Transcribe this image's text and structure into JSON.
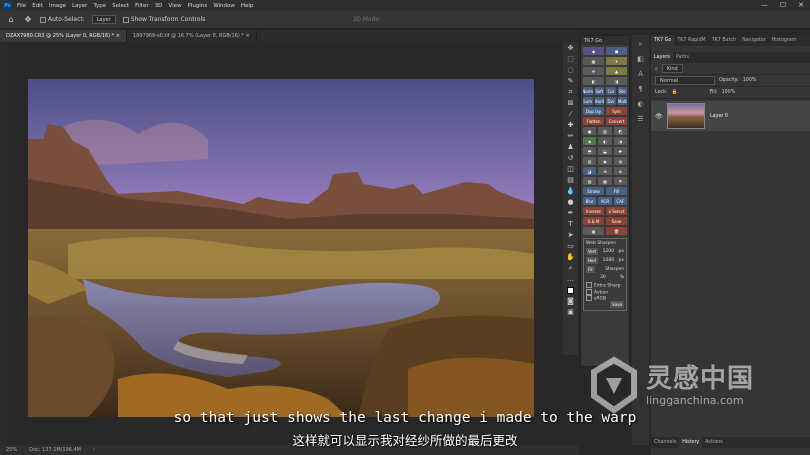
{
  "app": {
    "logo": "Ps"
  },
  "menu": [
    "File",
    "Edit",
    "Image",
    "Layer",
    "Type",
    "Select",
    "Filter",
    "3D",
    "View",
    "Plugins",
    "Window",
    "Help"
  ],
  "window_controls": [
    "—",
    "☐",
    "✕"
  ],
  "options_bar": {
    "auto_select_label": "Auto-Select:",
    "layer_dropdown": "Layer",
    "transform_label": "Show Transform Controls",
    "mode_3d": "3D Mode:"
  },
  "doc_tabs": [
    {
      "label": "DZAX7980.CR3 @ 25% (Layer 0, RGB/16) *",
      "close": "×"
    },
    {
      "label": "1897969-s0.tif @ 16.7% (Layer 0, RGB/16) *",
      "close": "×"
    }
  ],
  "status": {
    "zoom": "25%",
    "doc": "Doc: 137.1M/196.4M",
    "arrow": "›"
  },
  "t7_panel": {
    "title": "TK7 Go",
    "rows": [
      [
        "Norm",
        "Soft",
        "Col",
        "Sto"
      ],
      [
        "Lum",
        "Hard",
        "Dvi",
        "Mult"
      ],
      [
        "Dup lay",
        "Sym"
      ],
      [
        "Flatten",
        "Convert"
      ],
      [
        "Stroke",
        "Fill"
      ],
      [
        "Blur",
        "ACR",
        "CAF"
      ],
      [
        "Inverse",
        "x Select"
      ],
      [
        "S & M",
        "Save"
      ]
    ],
    "web_sharpen": {
      "title": "Web Sharpen",
      "vert_label": "Vert",
      "vert_value": "1200",
      "vert_unit": "px",
      "hori_label": "Hori",
      "hori_value": "1080",
      "hori_unit": "px",
      "fit_label": "Fit",
      "fit_caption": "Sharpen",
      "fit_value": "30",
      "fit_unit": "%",
      "options": [
        "Extra Sharp",
        "Action",
        "sRGB"
      ],
      "save": "Save"
    }
  },
  "panels": {
    "top_tabs": [
      "TK7 Go",
      "TK7 RapidM",
      "TK7 Batch",
      "Navigator",
      "Histogram"
    ],
    "layer_tabs": [
      "Layers",
      "Paths"
    ],
    "kind_label": "Kind",
    "blend_mode": "Normal",
    "opacity_label": "Opacity:",
    "opacity_value": "100%",
    "lock_label": "Lock:",
    "fill_label": "Fill:",
    "fill_value": "100%",
    "layer_name": "Layer 0",
    "bottom_tabs": [
      "Channels",
      "History",
      "Actions"
    ]
  },
  "subtitles": {
    "en": "so that just shows the last change i made to the warp",
    "zh": "这样就可以显示我对经纱所做的最后更改"
  },
  "watermark": {
    "cn": "灵感中国",
    "url": "lingganchina.com"
  },
  "icons": [
    "home-icon",
    "move-icon",
    "lasso-icon",
    "crop-icon",
    "brush-icon",
    "eraser-icon",
    "text-icon",
    "hand-icon",
    "zoom-icon",
    "eye-icon"
  ]
}
